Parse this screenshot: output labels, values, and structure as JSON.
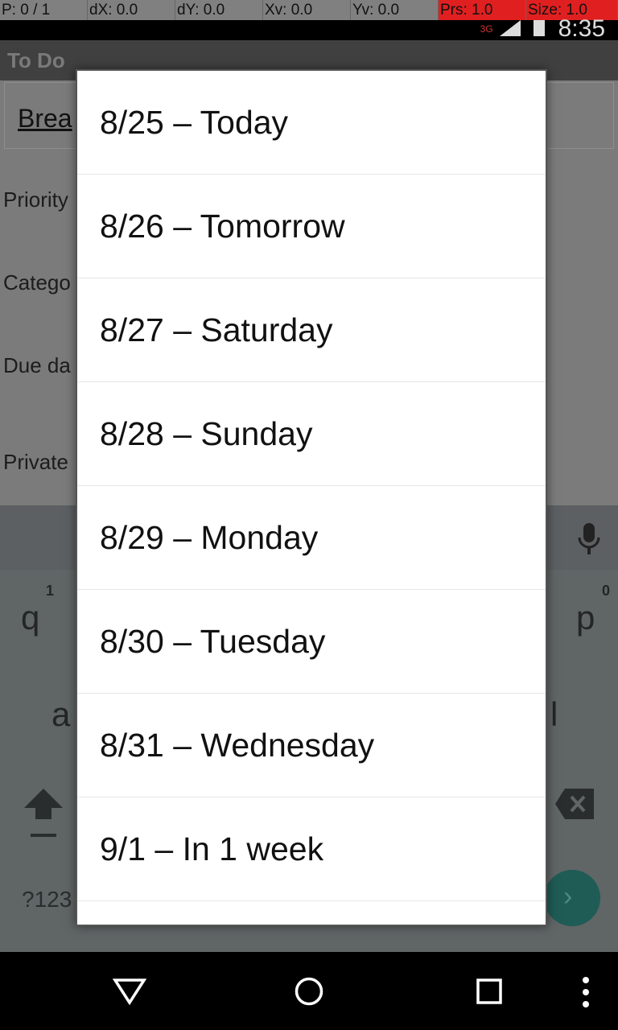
{
  "debug": {
    "p": "P: 0 / 1",
    "dx": "dX: 0.0",
    "dy": "dY: 0.0",
    "xv": "Xv: 0.0",
    "yv": "Yv: 0.0",
    "prs": "Prs: 1.0",
    "size": "Size: 1.0"
  },
  "status": {
    "time": "8:35",
    "network": "3G"
  },
  "app": {
    "title": "To Do",
    "field_value": "Brea"
  },
  "labels": {
    "priority": "Priority",
    "category": "Catego",
    "due": "Due da",
    "private": "Private"
  },
  "keyboard": {
    "q": "q",
    "q_hint": "1",
    "p": "p",
    "p_hint": "0",
    "a": "a",
    "l": "l",
    "sym": "?123"
  },
  "dialog": {
    "items": [
      "8/25 – Today",
      "8/26 – Tomorrow",
      "8/27 – Saturday",
      "8/28 – Sunday",
      "8/29 – Monday",
      "8/30 – Tuesday",
      "8/31 – Wednesday",
      "9/1 – In 1 week"
    ]
  },
  "colors": {
    "accent": "#1f5c55",
    "debug_red": "#e02020"
  }
}
